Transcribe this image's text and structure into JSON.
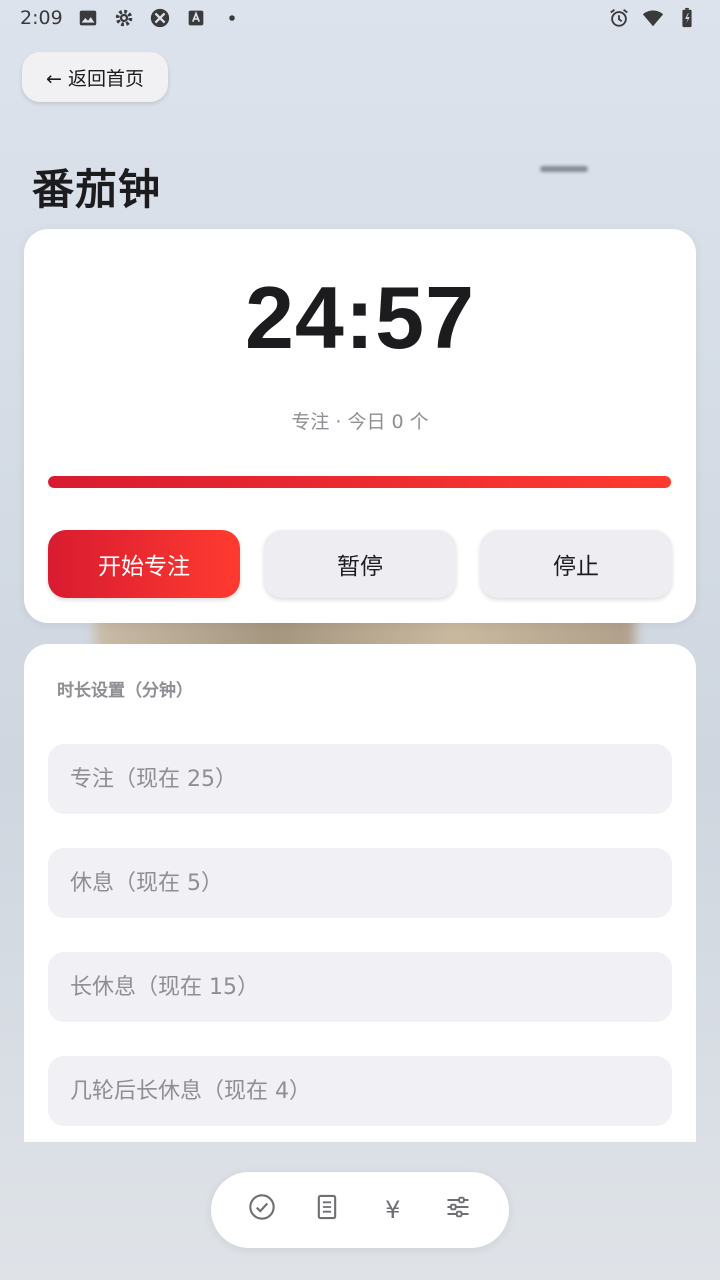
{
  "status_bar": {
    "time": "2:09",
    "left_icons": [
      "image-icon",
      "gear-icon",
      "app-icon",
      "keyboard-icon",
      "dot-icon"
    ],
    "right_icons": [
      "alarm-icon",
      "wifi-icon",
      "battery-icon"
    ]
  },
  "header": {
    "back_label": "← 返回首页",
    "title": "番茄钟"
  },
  "timer": {
    "display": "24:57",
    "subtitle": "专注 · 今日 0 个",
    "progress_fraction": 0.998,
    "accent_color": "#e5202f",
    "buttons": {
      "start": "开始专注",
      "pause": "暂停",
      "stop": "停止"
    }
  },
  "settings": {
    "title": "时长设置（分钟）",
    "fields": [
      {
        "placeholder": "专注（现在 25）"
      },
      {
        "placeholder": "休息（现在 5）"
      },
      {
        "placeholder": "长休息（现在 15）"
      },
      {
        "placeholder": "几轮后长休息（现在 4）"
      }
    ]
  },
  "bottom_nav": {
    "items": [
      {
        "icon": "check-circle-icon"
      },
      {
        "icon": "document-icon"
      },
      {
        "icon": "yen-icon",
        "glyph": "¥"
      },
      {
        "icon": "sliders-icon"
      }
    ]
  }
}
